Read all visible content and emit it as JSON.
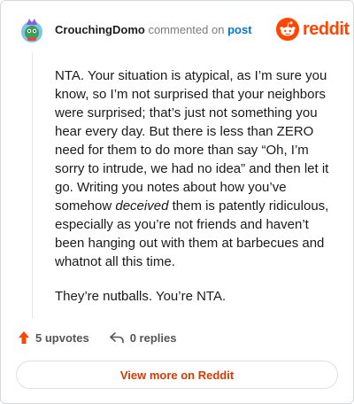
{
  "header": {
    "username": "CrouchingDomo",
    "commented_on_text": "commented on",
    "post_link": "post",
    "brand_wordmark": "reddit"
  },
  "comment": {
    "paragraph_1_part_1": "NTA. Your situation is atypical, as I’m sure you know, so I’m not surprised that your neighbors were surprised; that’s just not something you hear every day. But there is less than ZERO need for them to do more than say “Oh, I’m sorry to intrude, we had no idea” and then let it go. Writing you notes about how you’ve somehow ",
    "paragraph_1_emphasis": "deceived",
    "paragraph_1_part_2": " them is patently ridiculous, especially as you’re not friends and haven’t been hanging out with them at barbecues and whatnot all this time.",
    "paragraph_2": "They’re nutballs. You’re NTA."
  },
  "footer": {
    "upvotes": "5 upvotes",
    "replies": "0 replies"
  },
  "view_more_label": "View more on Reddit",
  "icons": {
    "avatar": "snoo-avatar-icon",
    "logo": "reddit-logo-icon",
    "upvote": "upvote-arrow-icon",
    "reply": "reply-arrow-icon"
  },
  "colors": {
    "brand": "#ff4500",
    "link": "#0079d3",
    "view_more_text": "#d93a00"
  }
}
